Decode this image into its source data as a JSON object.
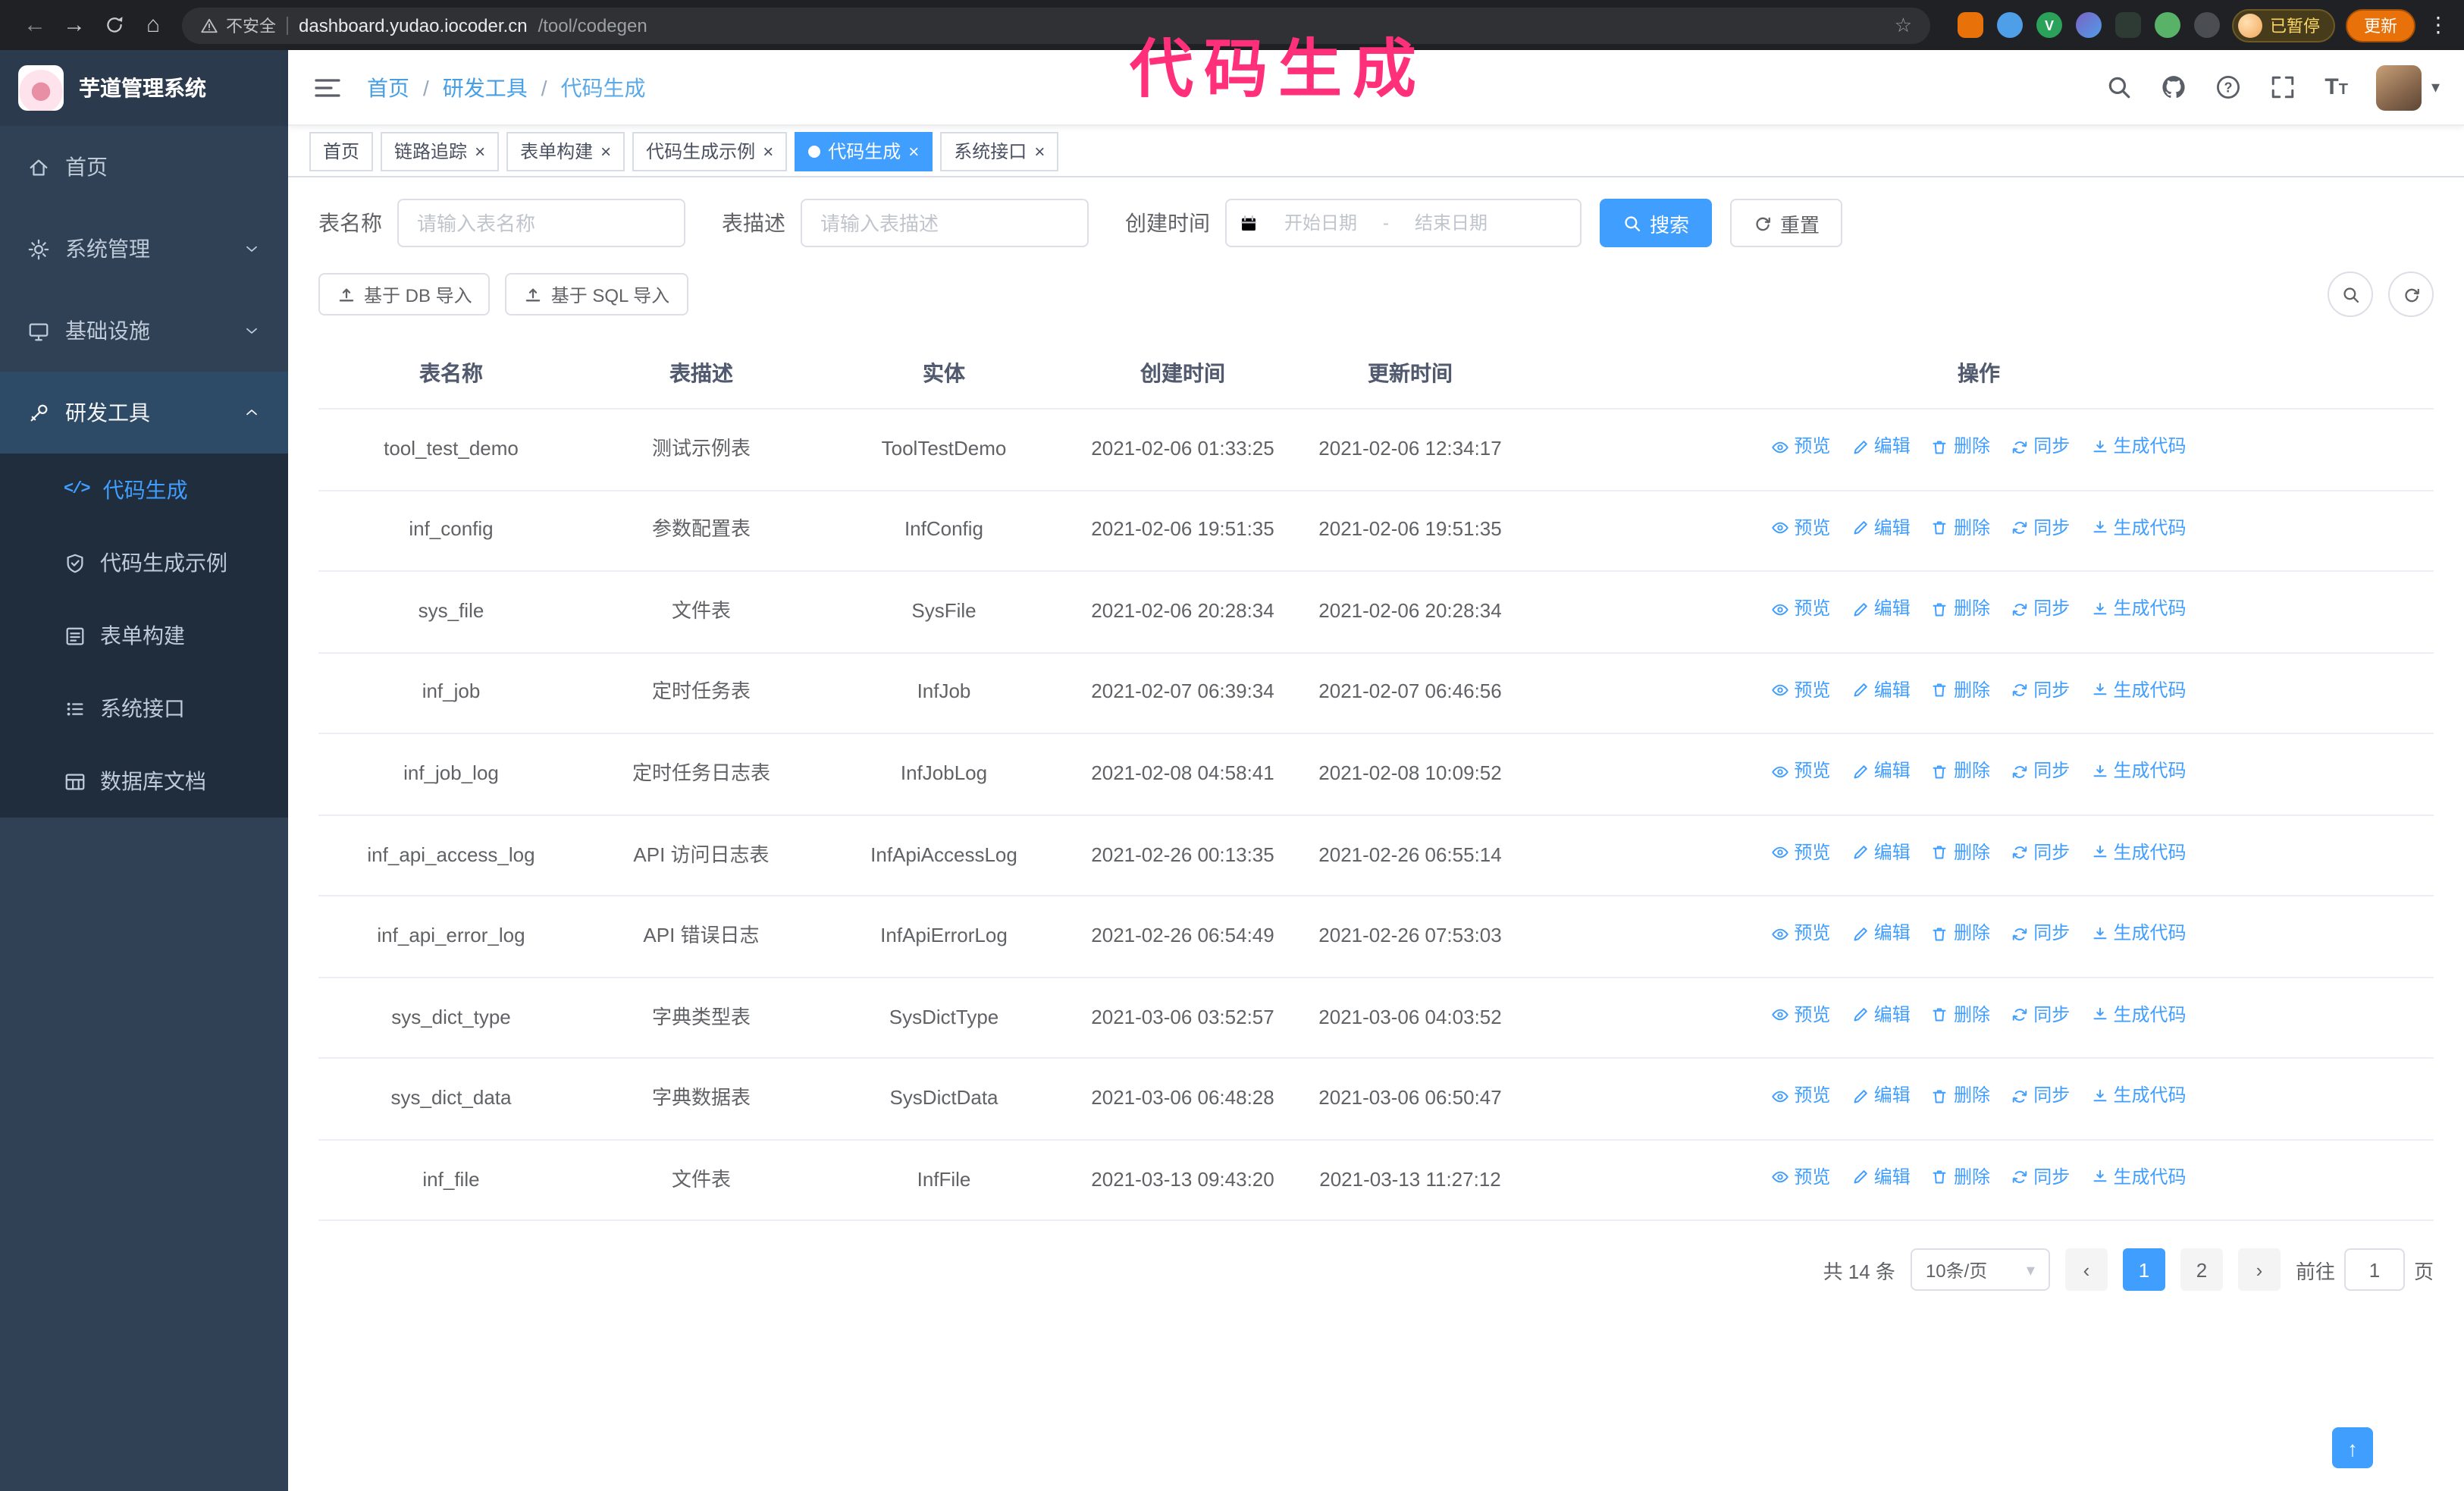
{
  "overlay": {
    "title": "代码生成"
  },
  "icons": {
    "back": "←",
    "forward": "→",
    "home_nav": "⌂",
    "star": "☆",
    "menu_dots": "⋮",
    "close": "×",
    "caret_down": "▾",
    "prev": "‹",
    "next": "›",
    "back_top": "↑",
    "code_glyph": "</>",
    "font_size_glyph": "T"
  },
  "browser": {
    "security_label": "不安全",
    "url_host": "dashboard.yudao.iocoder.cn",
    "url_path": "/tool/codegen",
    "profile_status": "已暂停",
    "update_label": "更新"
  },
  "sidebar": {
    "app_name": "芋道管理系统",
    "items": [
      {
        "label": "首页"
      },
      {
        "label": "系统管理"
      },
      {
        "label": "基础设施"
      },
      {
        "label": "研发工具"
      }
    ],
    "subitems": [
      {
        "label": "代码生成"
      },
      {
        "label": "代码生成示例"
      },
      {
        "label": "表单构建"
      },
      {
        "label": "系统接口"
      },
      {
        "label": "数据库文档"
      }
    ]
  },
  "breadcrumb": {
    "separator": "/",
    "items": [
      "首页",
      "研发工具",
      "代码生成"
    ]
  },
  "tabs": [
    {
      "label": "首页"
    },
    {
      "label": "链路追踪"
    },
    {
      "label": "表单构建"
    },
    {
      "label": "代码生成示例"
    },
    {
      "label": "代码生成"
    },
    {
      "label": "系统接口"
    }
  ],
  "filters": {
    "name_label": "表名称",
    "name_placeholder": "请输入表名称",
    "desc_label": "表描述",
    "desc_placeholder": "请输入表描述",
    "time_label": "创建时间",
    "start_placeholder": "开始日期",
    "end_placeholder": "结束日期",
    "range_separator": "-",
    "search_label": "搜索",
    "reset_label": "重置"
  },
  "toolbar": {
    "import_db": "基于 DB 导入",
    "import_sql": "基于 SQL 导入"
  },
  "table": {
    "columns": [
      "表名称",
      "表描述",
      "实体",
      "创建时间",
      "更新时间",
      "操作"
    ],
    "actions": [
      "预览",
      "编辑",
      "删除",
      "同步",
      "生成代码"
    ],
    "rows": [
      {
        "name": "tool_test_demo",
        "desc": "测试示例表",
        "entity": "ToolTestDemo",
        "created": "2021-02-06 01:33:25",
        "updated": "2021-02-06 12:34:17"
      },
      {
        "name": "inf_config",
        "desc": "参数配置表",
        "entity": "InfConfig",
        "created": "2021-02-06 19:51:35",
        "updated": "2021-02-06 19:51:35"
      },
      {
        "name": "sys_file",
        "desc": "文件表",
        "entity": "SysFile",
        "created": "2021-02-06 20:28:34",
        "updated": "2021-02-06 20:28:34"
      },
      {
        "name": "inf_job",
        "desc": "定时任务表",
        "entity": "InfJob",
        "created": "2021-02-07 06:39:34",
        "updated": "2021-02-07 06:46:56"
      },
      {
        "name": "inf_job_log",
        "desc": "定时任务日志表",
        "entity": "InfJobLog",
        "created": "2021-02-08 04:58:41",
        "updated": "2021-02-08 10:09:52"
      },
      {
        "name": "inf_api_access_log",
        "desc": "API 访问日志表",
        "entity": "InfApiAccessLog",
        "created": "2021-02-26 00:13:35",
        "updated": "2021-02-26 06:55:14"
      },
      {
        "name": "inf_api_error_log",
        "desc": "API 错误日志",
        "entity": "InfApiErrorLog",
        "created": "2021-02-26 06:54:49",
        "updated": "2021-02-26 07:53:03"
      },
      {
        "name": "sys_dict_type",
        "desc": "字典类型表",
        "entity": "SysDictType",
        "created": "2021-03-06 03:52:57",
        "updated": "2021-03-06 04:03:52"
      },
      {
        "name": "sys_dict_data",
        "desc": "字典数据表",
        "entity": "SysDictData",
        "created": "2021-03-06 06:48:28",
        "updated": "2021-03-06 06:50:47"
      },
      {
        "name": "inf_file",
        "desc": "文件表",
        "entity": "InfFile",
        "created": "2021-03-13 09:43:20",
        "updated": "2021-03-13 11:27:12"
      }
    ]
  },
  "pagination": {
    "total": "共 14 条",
    "page_size": "10条/页",
    "page1": "1",
    "page2": "2",
    "goto_label": "前往",
    "goto_value": "1",
    "page_unit": "页"
  },
  "colors": {
    "primary": "#409eff",
    "sidebar_bg": "#304156",
    "submenu_bg": "#1f2d3d",
    "chrome_bg": "#202124",
    "annotation": "#ff2f7a",
    "update_badge": "#e8710a",
    "paused_badge_text": "#fdd663"
  }
}
